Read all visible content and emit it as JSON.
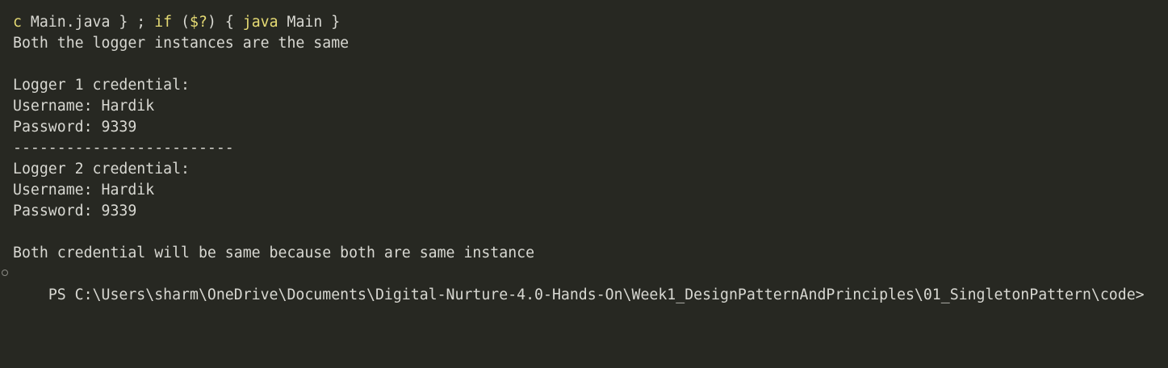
{
  "terminal": {
    "command": {
      "c_token": "c",
      "file": " Main.java",
      "close_brace": " }",
      "semicolon": " ;",
      "if_kw": " if",
      "paren_open": " (",
      "status_var": "$?",
      "paren_close": ")",
      "open_brace": " {",
      "java_kw": " java",
      "main_arg": " Main",
      "end_brace": " }"
    },
    "lines": [
      "Both the logger instances are the same",
      "",
      "Logger 1 credential:",
      "Username: Hardik",
      "Password: 9339",
      "-------------------------",
      "Logger 2 credential:",
      "Username: Hardik",
      "Password: 9339",
      "",
      "Both credential will be same because both are same instance"
    ],
    "prompt": "PS C:\\Users\\sharm\\OneDrive\\Documents\\Digital-Nurture-4.0-Hands-On\\Week1_DesignPatternAndPrinciples\\01_SingletonPattern\\code>"
  },
  "colors": {
    "background": "#272822",
    "text": "#d8d8d2",
    "keyword": "#e6db74"
  }
}
